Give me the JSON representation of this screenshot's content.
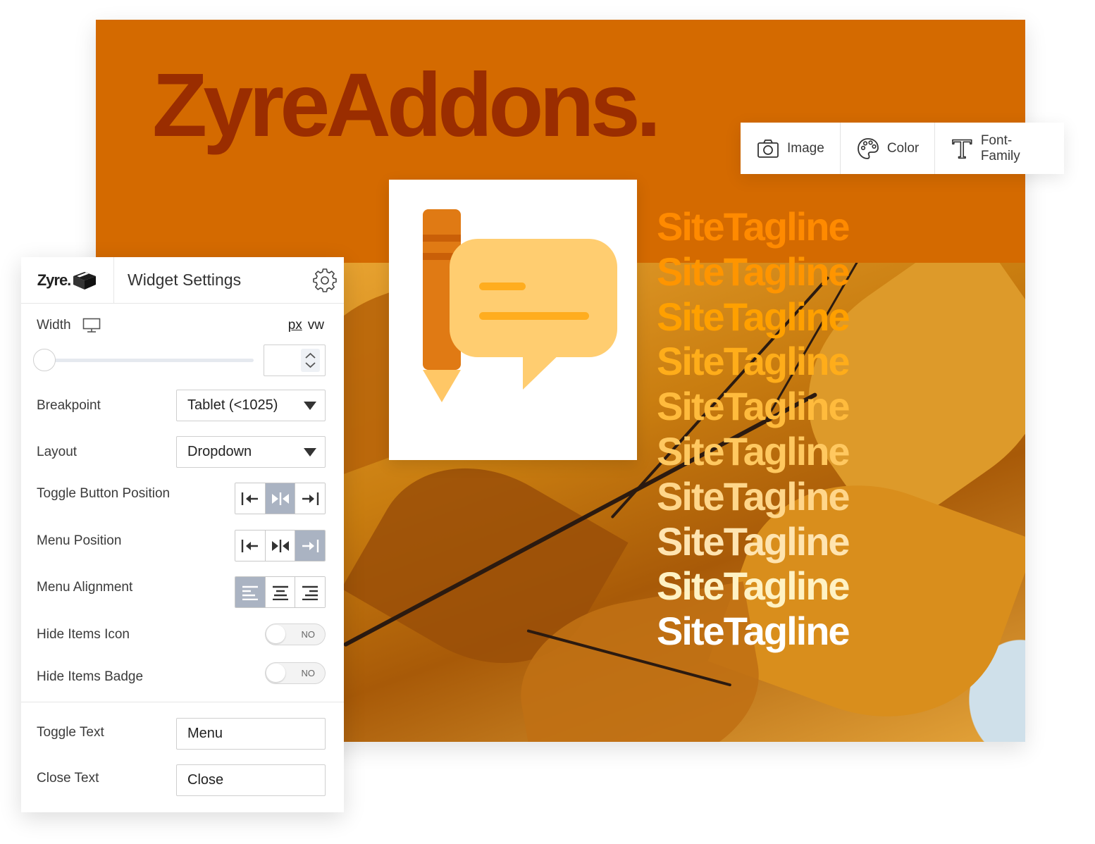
{
  "hero": {
    "title": "ZyreAddons."
  },
  "toolbar": {
    "items": [
      {
        "label": "Image",
        "icon": "camera-icon"
      },
      {
        "label": "Color",
        "icon": "palette-icon"
      },
      {
        "label": "Font-Family",
        "icon": "type-icon"
      }
    ]
  },
  "taglines": {
    "text": "SiteTagline",
    "colors": [
      "#ff8a00",
      "#ff9500",
      "#ffa000",
      "#ffad1a",
      "#ffbb3d",
      "#ffc860",
      "#ffd68a",
      "#ffe4b0",
      "#fff2c4",
      "#ffffff"
    ]
  },
  "panel": {
    "logo": "Zyre.",
    "title": "Widget Settings",
    "width": {
      "label": "Width",
      "unit_px": "px",
      "unit_vw": "vw",
      "value": ""
    },
    "breakpoint": {
      "label": "Breakpoint",
      "value": "Tablet (<1025)"
    },
    "layout": {
      "label": "Layout",
      "value": "Dropdown"
    },
    "toggle_button_position": {
      "label": "Toggle Button Position",
      "selected": "center"
    },
    "menu_position": {
      "label": "Menu Position",
      "selected": "right"
    },
    "menu_alignment": {
      "label": "Menu Alignment",
      "selected": "left"
    },
    "hide_items_icon": {
      "label": "Hide Items Icon",
      "state": "NO"
    },
    "hide_items_badge": {
      "label": "Hide Items Badge",
      "state": "NO"
    },
    "toggle_text": {
      "label": "Toggle Text",
      "value": "Menu"
    },
    "close_text": {
      "label": "Close Text",
      "value": "Close"
    }
  },
  "colors": {
    "hero_bg": "#d46a00",
    "hero_title": "#9a2d00",
    "segment_active": "#aab3c2"
  }
}
